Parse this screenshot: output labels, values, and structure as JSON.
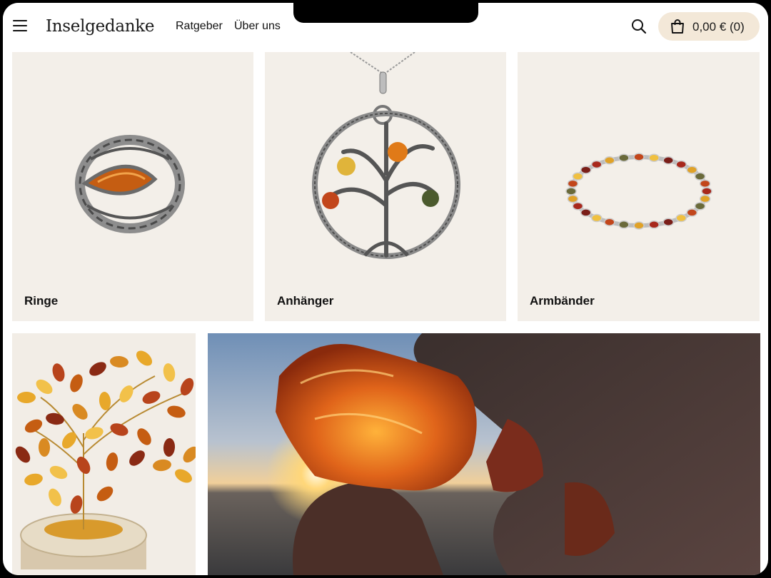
{
  "header": {
    "logo": "Inselgedanke",
    "nav": [
      {
        "label": "Ratgeber"
      },
      {
        "label": "Über uns"
      }
    ],
    "cart_label": "0,00 € (0)"
  },
  "categories": [
    {
      "label": "Ringe"
    },
    {
      "label": "Anhänger"
    },
    {
      "label": "Armbänder"
    }
  ],
  "colors": {
    "tile_bg": "#f3efe9",
    "cart_bg": "#f3e8d8",
    "amber": "#d9761a"
  }
}
